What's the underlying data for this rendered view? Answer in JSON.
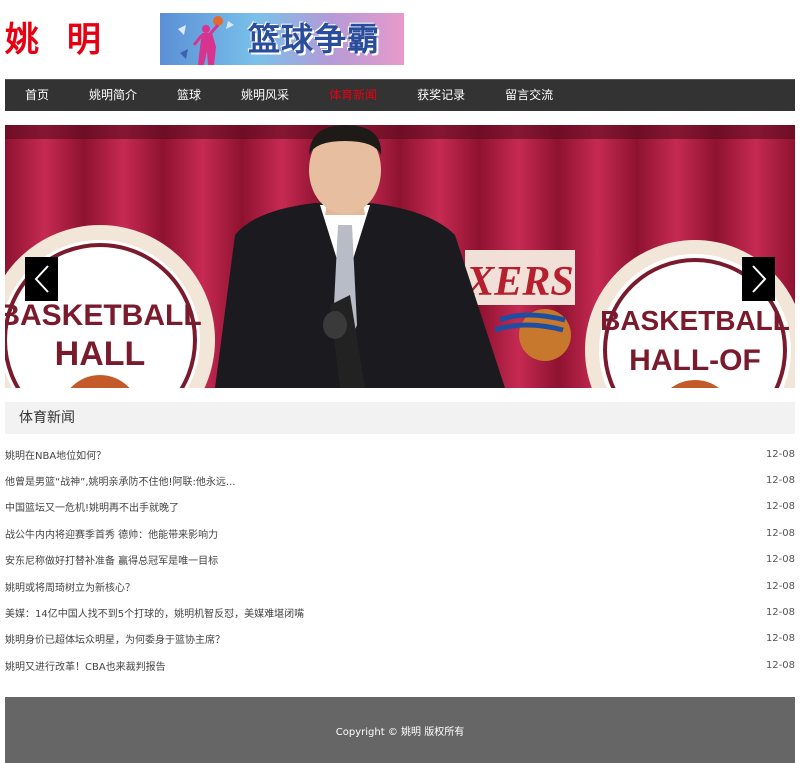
{
  "header": {
    "logo_text": "姚 明",
    "banner_text": "篮球争霸"
  },
  "nav": {
    "items": [
      {
        "label": "首页"
      },
      {
        "label": "姚明简介"
      },
      {
        "label": "篮球"
      },
      {
        "label": "姚明风采"
      },
      {
        "label": "体育新闻"
      },
      {
        "label": "获奖记录"
      },
      {
        "label": "留言交流"
      }
    ],
    "active_index": 4
  },
  "slider": {
    "prev_icon": "chevron-left-icon",
    "next_icon": "chevron-right-icon",
    "curtain_color": "#b81f44",
    "emblem_text_left": "BASKETBALL",
    "emblem_sub_left": "HALL",
    "emblem_text_center": "XERS",
    "emblem_text_right": "BASKETBALL",
    "emblem_sub_right": "HALL-OF"
  },
  "section": {
    "title": "体育新闻"
  },
  "news": [
    {
      "title": "姚明在NBA地位如何？",
      "date": "12-08"
    },
    {
      "title": "他曾是男篮“战神”,姚明亲承防不住他!阿联:他永远...",
      "date": "12-08"
    },
    {
      "title": "中国篮坛又一危机!姚明再不出手就晚了",
      "date": "12-08"
    },
    {
      "title": "战公牛内内将迎赛季首秀 德帅：他能带来影响力",
      "date": "12-08"
    },
    {
      "title": "安东尼称做好打替补准备 赢得总冠军是唯一目标",
      "date": "12-08"
    },
    {
      "title": "姚明或将周琦树立为新核心？",
      "date": "12-08"
    },
    {
      "title": "美媒：14亿中国人找不到5个打球的，姚明机智反怼，美媒难堪闭嘴",
      "date": "12-08"
    },
    {
      "title": "姚明身价已超体坛众明星，为何委身于篮协主席？",
      "date": "12-08"
    },
    {
      "title": "姚明又进行改革！CBA也来裁判报告",
      "date": "12-08"
    }
  ],
  "footer": {
    "copyright": "Copyright © 姚明 版权所有"
  },
  "colors": {
    "brand_red": "#e60012",
    "nav_bg": "#333333",
    "footer_bg": "#666666",
    "section_bg": "#f2f2f2"
  }
}
